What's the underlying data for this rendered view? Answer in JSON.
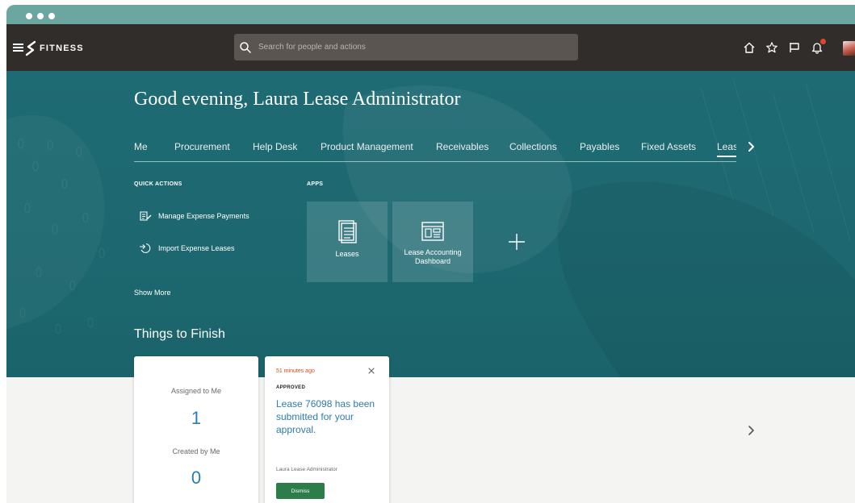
{
  "header": {
    "logo_text": "FITNESS",
    "search_placeholder": "Search for people and actions",
    "icons": [
      "home-icon",
      "star-icon",
      "flag-icon",
      "bell-icon"
    ]
  },
  "greeting": "Good evening, Laura Lease Administrator",
  "tabs": [
    {
      "label": "Me"
    },
    {
      "label": "Procurement"
    },
    {
      "label": "Help Desk"
    },
    {
      "label": "Product Management"
    },
    {
      "label": "Receivables"
    },
    {
      "label": "Collections"
    },
    {
      "label": "Payables"
    },
    {
      "label": "Fixed Assets"
    },
    {
      "label": "Lease",
      "active": true
    }
  ],
  "quick_actions": {
    "title": "QUICK ACTIONS",
    "items": [
      {
        "label": "Manage Expense Payments",
        "icon": "document-edit-icon"
      },
      {
        "label": "Import Expense Leases",
        "icon": "import-icon"
      }
    ],
    "show_more": "Show More"
  },
  "apps": {
    "title": "APPS",
    "items": [
      {
        "label": "Leases",
        "icon": "document-icon"
      },
      {
        "label": "Lease Accounting Dashboard",
        "icon": "dashboard-icon"
      }
    ]
  },
  "things_to_finish": {
    "title": "Things to Finish",
    "assigned_label": "Assigned to Me",
    "assigned_count": "1",
    "created_label": "Created by Me",
    "created_count": "0"
  },
  "notification": {
    "time": "51 minutes ago",
    "status": "APPROVED",
    "message": "Lease 76098 has been submitted for your approval.",
    "user": "Laura Lease Administrator",
    "dismiss_label": "Dismiss"
  },
  "colors": {
    "hero": "#1d6870",
    "topbar": "#312d2a",
    "chrome": "#6ba7a0",
    "link": "#2f7bae",
    "dismiss": "#2d7d4a",
    "notification_time": "#d0491f"
  }
}
